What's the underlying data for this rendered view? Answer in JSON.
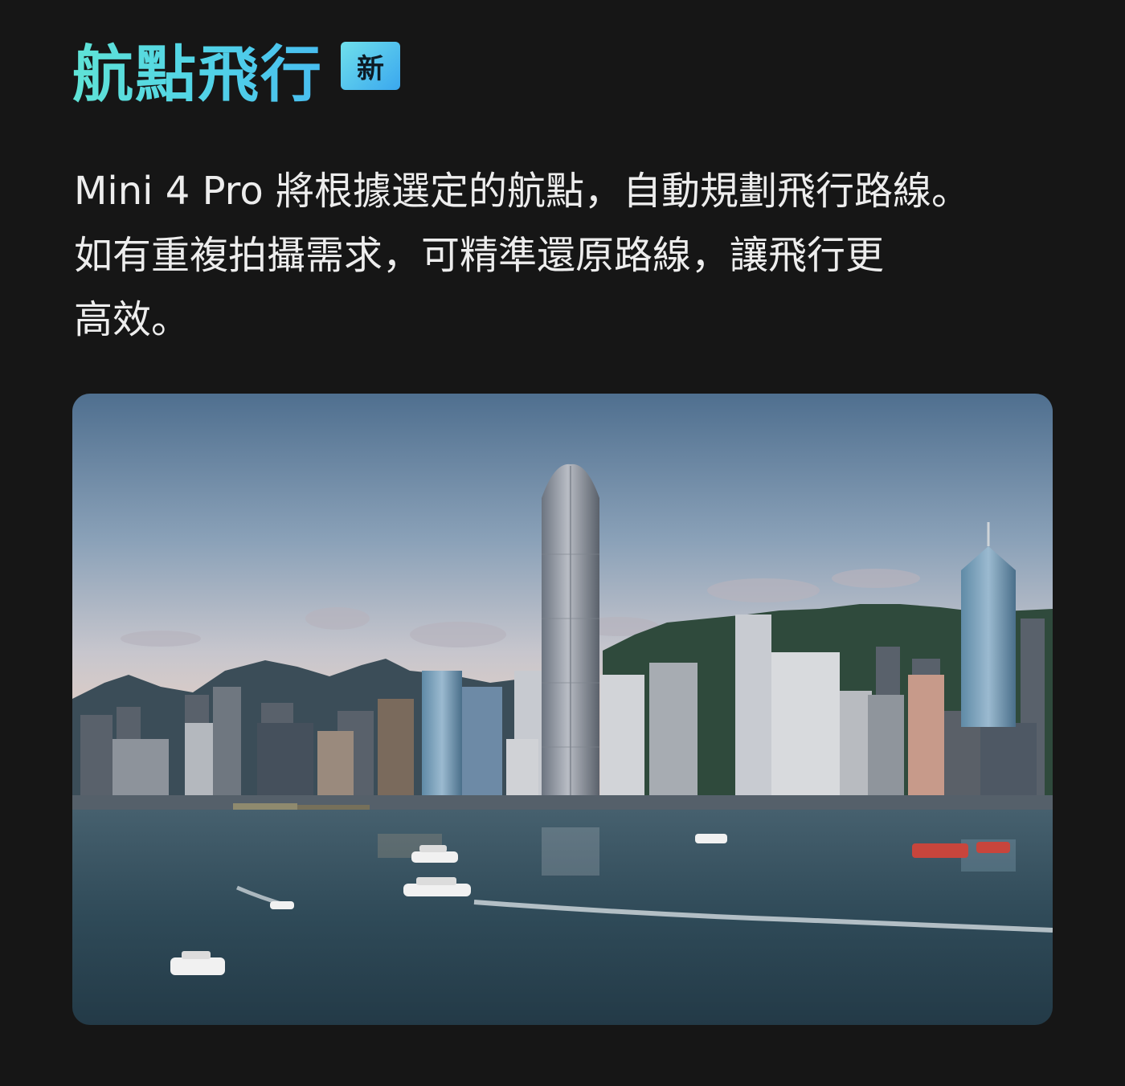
{
  "header": {
    "title": "航點飛行",
    "badge": "新"
  },
  "description": {
    "lines": [
      "Mini 4 Pro 將根據選定的航點，自動規劃飛行路線。",
      "如有重複拍攝需求，可精準還原路線，讓飛行更",
      "高效。"
    ]
  },
  "photo": {
    "subject": "harbor-skyline-photo"
  },
  "colors": {
    "background": "#161616",
    "title_gradient_start": "#5fe3d6",
    "title_gradient_end": "#48bdf0",
    "badge_start": "#6fe0ec",
    "badge_end": "#3aa7ee"
  }
}
